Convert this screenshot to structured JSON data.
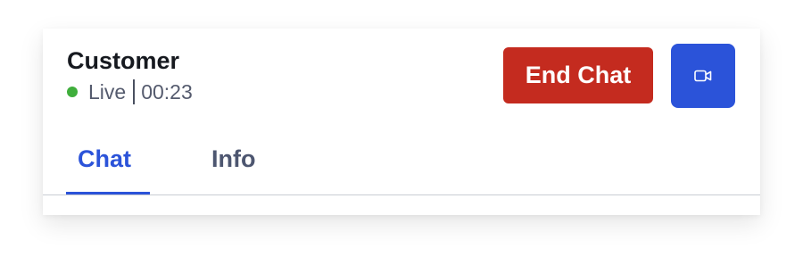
{
  "header": {
    "title": "Customer",
    "status_label": "Live",
    "timer": "00:23"
  },
  "actions": {
    "end_chat_label": "End Chat",
    "video_icon": "video-camera-icon"
  },
  "tabs": [
    {
      "label": "Chat",
      "active": true
    },
    {
      "label": "Info",
      "active": false
    }
  ],
  "colors": {
    "live_indicator": "#3fae3c",
    "end_chat_button": "#c42b1f",
    "primary": "#2b53d9",
    "inactive_tab": "#4d5670"
  }
}
